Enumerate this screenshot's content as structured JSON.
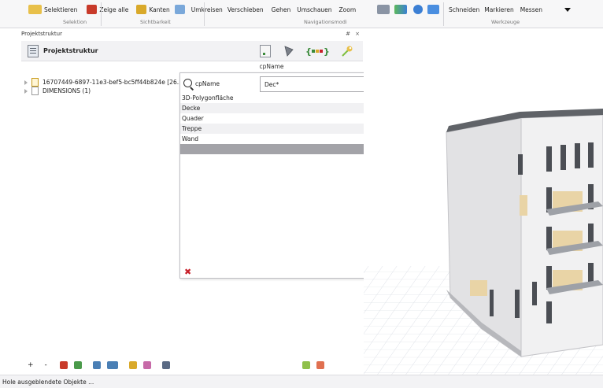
{
  "ribbon": {
    "row1": [
      {
        "label": "Selektieren",
        "icon": "select-icon"
      },
      {
        "label": "Zeige alle",
        "icon": "show-all-icon"
      },
      {
        "label": "Kanten",
        "icon": "edges-icon"
      },
      {
        "label": "Umkreisen",
        "icon": ""
      },
      {
        "label": "Verschieben",
        "icon": ""
      },
      {
        "label": "Gehen",
        "icon": ""
      },
      {
        "label": "Umschauen",
        "icon": ""
      },
      {
        "label": "Zoom",
        "icon": ""
      }
    ],
    "tools": [
      "Schneiden",
      "Markieren",
      "Messen"
    ],
    "groups": [
      "Selektion",
      "Sichtbarkeit",
      "Navigationsmodi",
      "Werkzeuge"
    ]
  },
  "panel": {
    "title": "Projektstruktur",
    "header_title": "Projektstruktur",
    "pin": "#",
    "close": "×",
    "column_header": "cpName"
  },
  "tree": [
    {
      "label": "16707449-6897-11e3-bef5-bc5ff44b824e [26...",
      "icon": "ifc-file-icon"
    },
    {
      "label": "DIMENSIONS (1)",
      "icon": "document-icon"
    }
  ],
  "filter": {
    "label": "cpName",
    "value": "Dec*",
    "options": [
      "3D-Polygonfläche",
      "Decke",
      "Quader",
      "Treppe",
      "Wand",
      ""
    ]
  },
  "bottom_bar": {
    "plus": "+",
    "minus": "-"
  },
  "status": "Hole ausgeblendete Objekte ...",
  "colors": {
    "accent_blue": "#3b7fd4",
    "close_red": "#c8202a",
    "selected_row": "#a3a3a8"
  }
}
